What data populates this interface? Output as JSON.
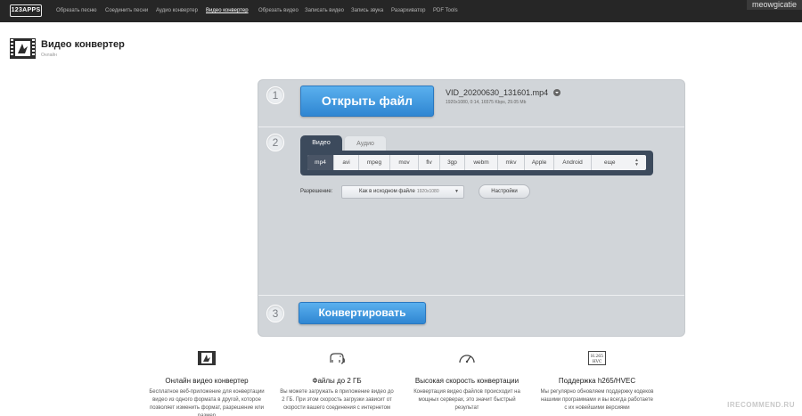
{
  "nav": {
    "logo": "123APPS",
    "items": [
      {
        "label": "Обрезать песню",
        "active": false
      },
      {
        "label": "Соединить песни",
        "active": false
      },
      {
        "label": "Аудио конвертер",
        "active": false
      },
      {
        "label": "Видео конвертер",
        "active": true
      },
      {
        "label": "Обрезать видео",
        "active": false
      },
      {
        "label": "Записать видео",
        "active": false
      },
      {
        "label": "Запись звука",
        "active": false
      },
      {
        "label": "Разархиватор",
        "active": false
      },
      {
        "label": "PDF Tools",
        "active": false
      }
    ],
    "watermark": "meowgicatie"
  },
  "header": {
    "title": "Видео конвертер",
    "subtitle": "Онлайн"
  },
  "step1": {
    "num": "1",
    "open_button": "Открыть файл",
    "file_name": "VID_20200630_131601.mp4",
    "file_meta": "1920x1080, 0:14, 16575 Kbps, 29.05 Mb"
  },
  "step2": {
    "num": "2",
    "tabs": {
      "video": "Видео",
      "audio": "Аудио"
    },
    "formats": [
      {
        "label": "mp4",
        "selected": true
      },
      {
        "label": "avi",
        "selected": false
      },
      {
        "label": "mpeg",
        "selected": false
      },
      {
        "label": "mov",
        "selected": false
      },
      {
        "label": "flv",
        "selected": false
      },
      {
        "label": "3gp",
        "selected": false
      },
      {
        "label": "webm",
        "selected": false
      },
      {
        "label": "mkv",
        "selected": false
      },
      {
        "label": "Apple",
        "selected": false
      },
      {
        "label": "Android",
        "selected": false
      }
    ],
    "more_label": "еще",
    "resolution_label": "Разрешение:",
    "resolution_value": "Как в исходном файле",
    "resolution_dim": "1920x1080",
    "settings_button": "Настройки"
  },
  "step3": {
    "num": "3",
    "convert_button": "Конвертировать"
  },
  "features": [
    {
      "icon": "film-icon",
      "title": "Онлайн видео конвертер",
      "text": "Бесплатное веб-приложение для конвертации видео из одного формата в другой, которое позволяет изменить формат, разрешение или размер"
    },
    {
      "icon": "elephant-icon",
      "title": "Файлы до 2 ГБ",
      "text": "Вы можете загружать в приложение видео до 2 ГБ. При этом скорость загрузки зависит от скорости вашего соединения с интернетом"
    },
    {
      "icon": "speedometer-icon",
      "title": "Высокая скорость конвертации",
      "text": "Конвертация видео файлов происходит на мощных серверах, это значит быстрый результат"
    },
    {
      "icon": "hevc-icon",
      "title": "Поддержка h265/HVEC",
      "text": "Мы регулярно обновляем поддержку кодеков нашими программами и вы всегда работаете с их новейшими версиями"
    }
  ],
  "hevc_badge": {
    "line1": "H.265",
    "line2": "HVC"
  },
  "irecommend": "IRECOMMEND.RU",
  "colors": {
    "primary_button": "#3a93dc",
    "format_bar": "#3c4a5c",
    "panel": "#d1d5d9"
  }
}
